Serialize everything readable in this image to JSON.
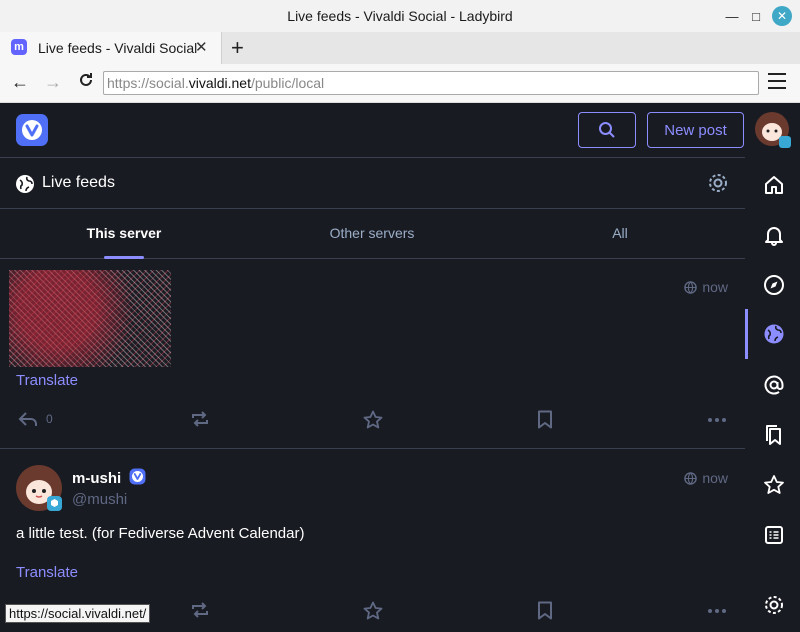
{
  "window": {
    "title": "Live feeds - Vivaldi Social - Ladybird"
  },
  "tab": {
    "title": "Live feeds - Vivaldi Social",
    "favicon": "mastodon-icon"
  },
  "address": {
    "prefix": "https://social.",
    "host": "vivaldi.net",
    "path": "/public/local"
  },
  "header": {
    "new_post": "New post"
  },
  "column": {
    "title": "Live feeds",
    "tabs": [
      "This server",
      "Other servers",
      "All"
    ],
    "active_tab": 0
  },
  "posts": [
    {
      "time": "now",
      "translate": "Translate",
      "reply_count": "0"
    },
    {
      "display_name": "m-ushi",
      "handle": "@mushi",
      "time": "now",
      "content": "a little test. (for Fediverse Advent Calendar)",
      "translate": "Translate"
    }
  ],
  "status_bar": {
    "hover_url": "https://social.vivaldi.net/"
  },
  "colors": {
    "accent": "#8c8dff",
    "background": "#191b22",
    "muted": "#606984",
    "brand": "#4f6ff7"
  }
}
